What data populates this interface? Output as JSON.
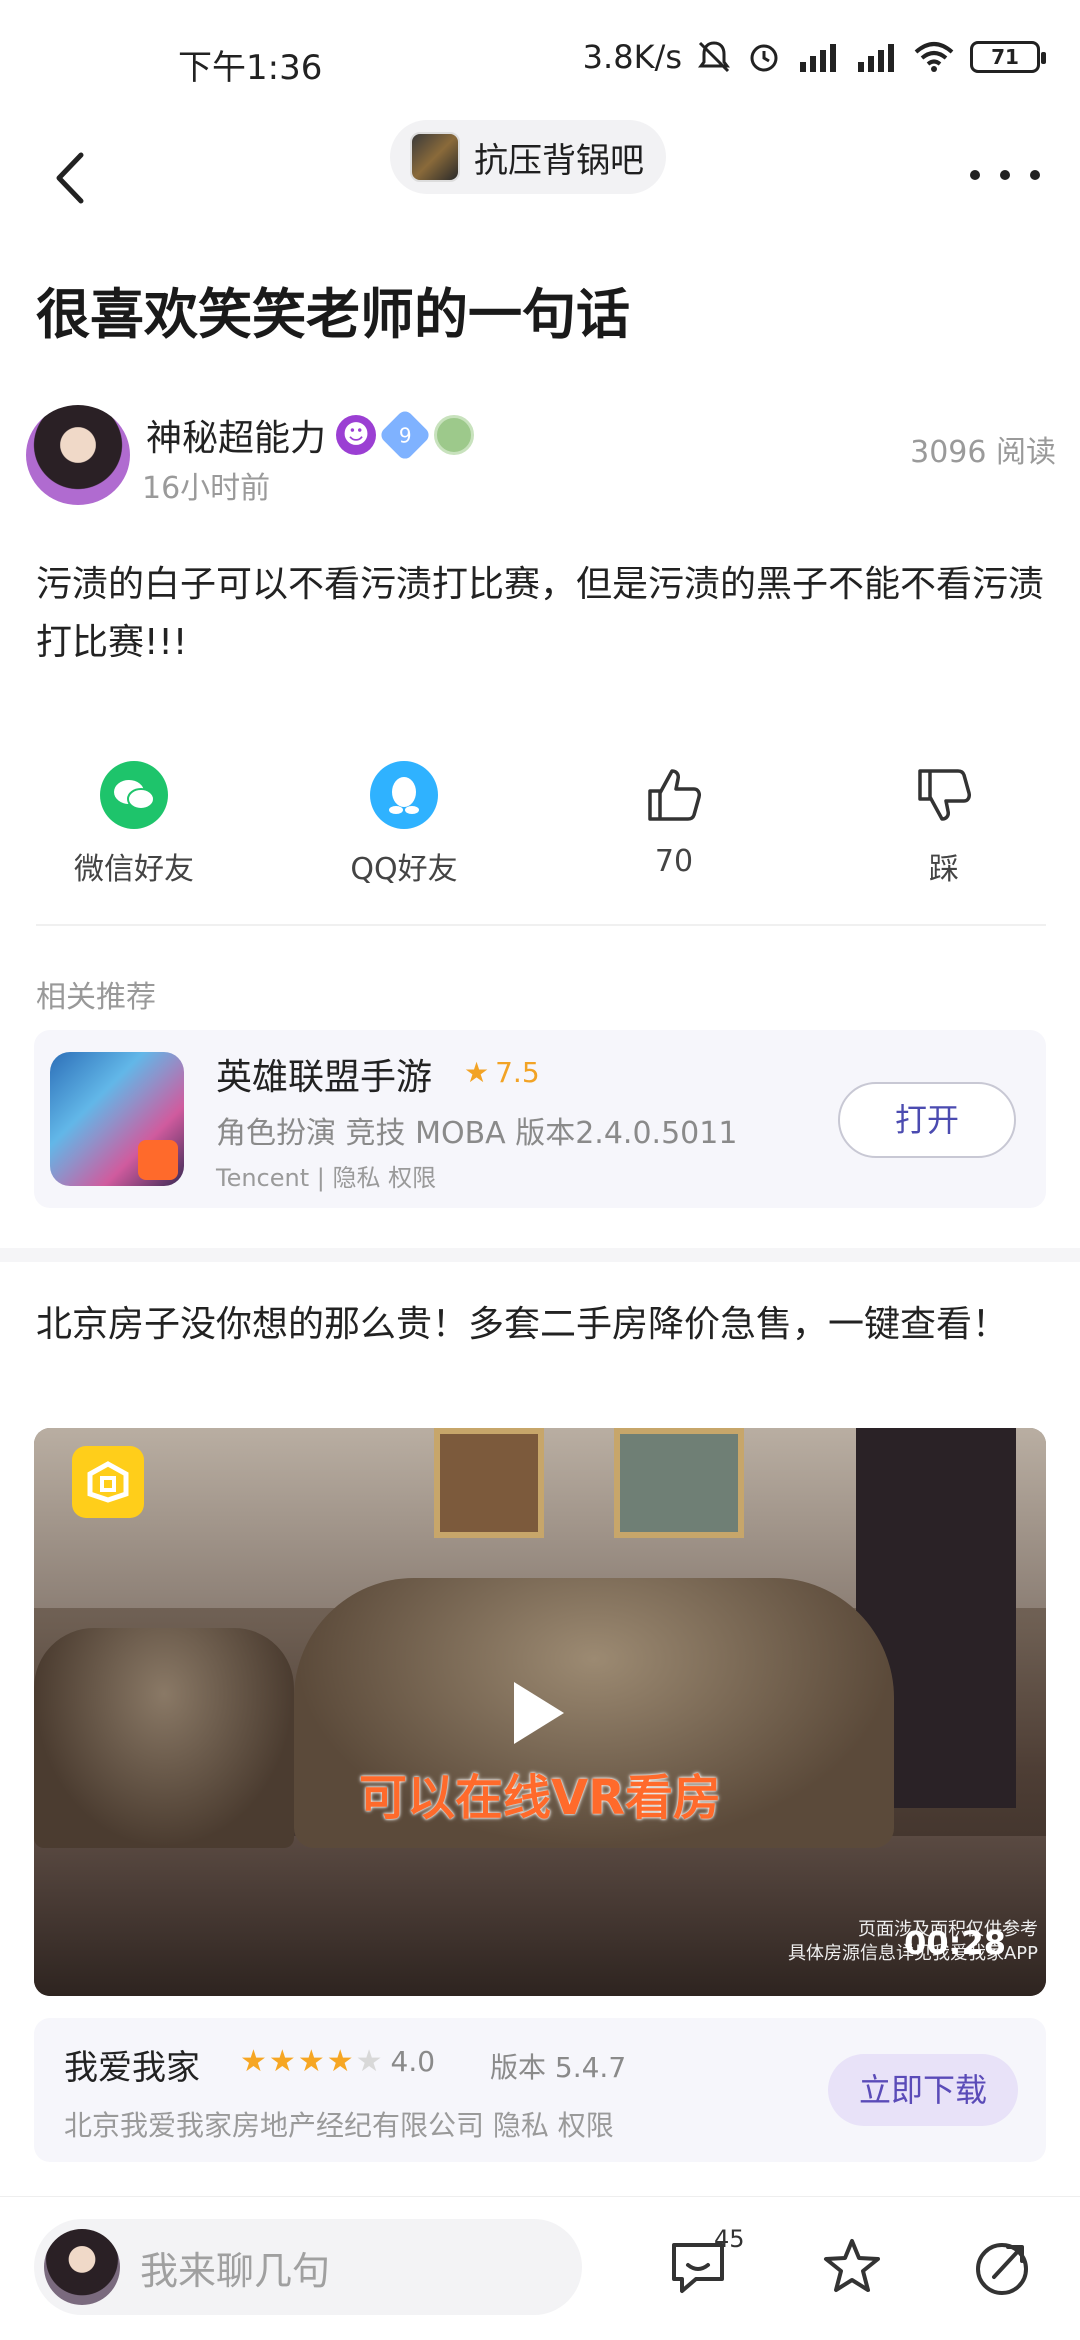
{
  "status_bar": {
    "time": "下午1:36",
    "network_speed": "3.8K/s",
    "battery": "71"
  },
  "header": {
    "forum_name": "抗压背锅吧"
  },
  "post": {
    "title": "很喜欢笑笑老师的一句话",
    "author": {
      "name": "神秘超能力",
      "level": "9",
      "time": "16小时前"
    },
    "read_count": "3096 阅读",
    "body": "污渍的白子可以不看污渍打比赛，但是污渍的黑子不能不看污渍打比赛!!!"
  },
  "actions": {
    "wechat_label": "微信好友",
    "qq_label": "QQ好友",
    "like_count": "70",
    "dislike_label": "踩"
  },
  "related": {
    "label": "相关推荐",
    "app": {
      "name": "英雄联盟手游",
      "rating": "7.5",
      "meta": "角色扮演  竞技  MOBA   版本2.4.0.5011",
      "publisher": "Tencent | 隐私  权限",
      "button": "打开"
    }
  },
  "ad": {
    "title": "北京房子没你想的那么贵！多套二手房降价急售，一键查看！",
    "video": {
      "caption": "可以在线VR看房",
      "duration": "00:28",
      "disclaimer_line1": "页面涉及面积仅供参考",
      "disclaimer_line2": "具体房源信息详见我爱我家APP"
    },
    "app": {
      "name": "我爱我家",
      "rating": "4.0",
      "stars": 4,
      "version": "版本 5.4.7",
      "company": "北京我爱我家房地产经纪有限公司   隐私    权限",
      "button": "立即下载"
    }
  },
  "bottom_bar": {
    "placeholder": "我来聊几句",
    "comment_count": "45"
  },
  "colors": {
    "accent": "#5a4bb8",
    "wechat": "#1ec46b",
    "qq": "#2fb2ff",
    "star": "#f6a623"
  }
}
